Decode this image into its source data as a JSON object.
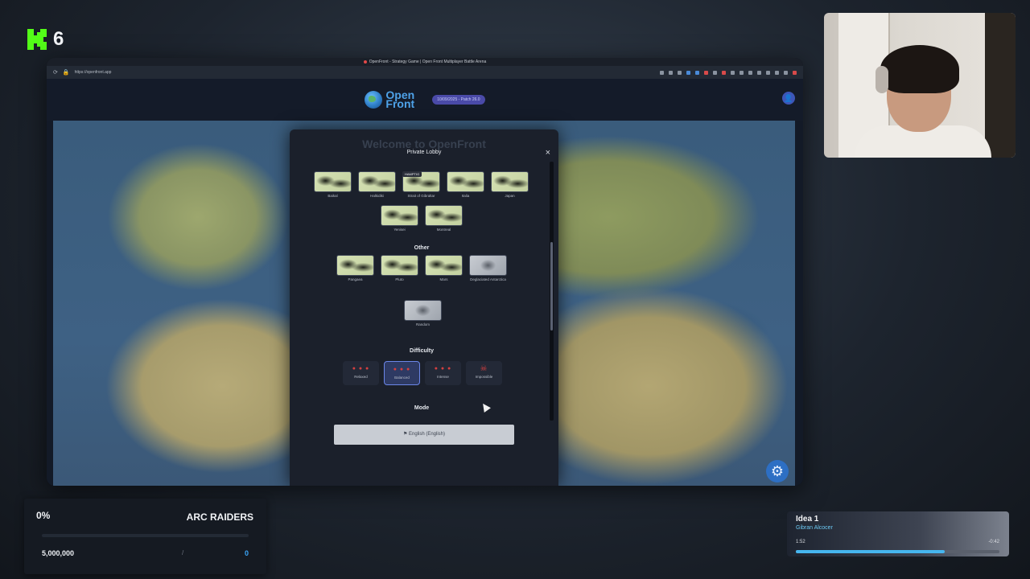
{
  "overlay": {
    "viewer_count": "6"
  },
  "browser": {
    "tab_title": "OpenFront - Strategy Game | Open Front Multiplayer Battle Arena",
    "url": "https://openfront.app"
  },
  "site": {
    "logo_line1": "Open",
    "logo_line2": "Front",
    "version_badge": "10/09/2025 - Patch 26.0"
  },
  "modal": {
    "ghost_title": "Welcome to OpenFront",
    "title": "Private Lobby",
    "close_label": "×",
    "overlay_label": "HAMPTIG",
    "maps_row1": [
      {
        "label": "Baikal"
      },
      {
        "label": "Halkidiki"
      },
      {
        "label": "Strait of Gibraltar"
      },
      {
        "label": "Italia"
      },
      {
        "label": "Japan"
      }
    ],
    "maps_row2": [
      {
        "label": "Yenisei"
      },
      {
        "label": "Montreal"
      }
    ],
    "other_title": "Other",
    "maps_other": [
      {
        "label": "Pangaea"
      },
      {
        "label": "Pluto"
      },
      {
        "label": "Mars"
      },
      {
        "label": "Deglaciated Antarctica"
      }
    ],
    "random_label": "Random",
    "difficulty_title": "Difficulty",
    "difficulties": [
      {
        "label": "Relaxed",
        "icon": "● ● ●"
      },
      {
        "label": "Balanced",
        "icon": "● ● ●"
      },
      {
        "label": "Intense",
        "icon": "● ● ●"
      },
      {
        "label": "Impossible",
        "icon": "☠"
      }
    ],
    "mode_title": "Mode",
    "language_button": "English (English)"
  },
  "goal": {
    "percent": "0%",
    "title": "ARC RAIDERS",
    "progress_fraction": 0,
    "target": "5,000,000",
    "separator": "/",
    "current": "0"
  },
  "music": {
    "title": "Idea 1",
    "artist": "Gibran Alcocer",
    "elapsed": "1:52",
    "remaining": "-0:42",
    "progress_fraction": 0.73
  },
  "colors": {
    "accent": "#3b8ef0",
    "brand_green": "#53fc18",
    "music_accent": "#46b6ef"
  }
}
